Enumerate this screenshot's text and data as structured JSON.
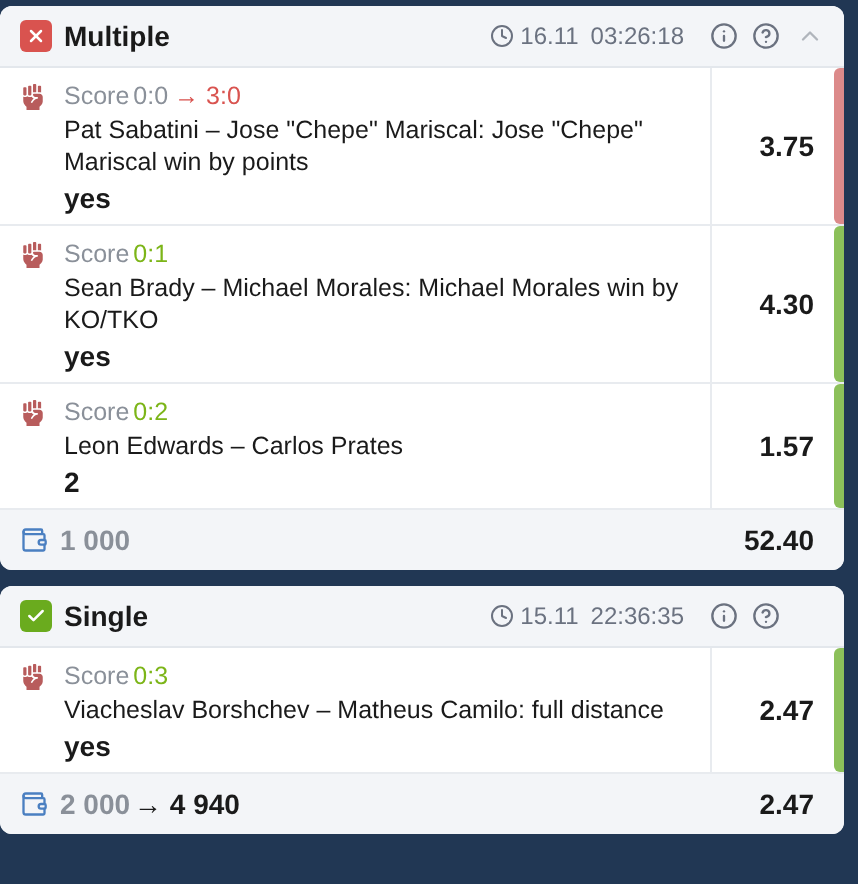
{
  "bets": [
    {
      "type": "Multiple",
      "won": false,
      "date": "16.11",
      "time": "03:26:18",
      "collapsible": true,
      "events": [
        {
          "score_label": "Score",
          "score": "0:0",
          "new_score": "→ 3:0",
          "won": false,
          "description": "Pat Sabatini – Jose \"Chepe\" Mariscal: Jose \"Chepe\" Mariscal win by points",
          "pick": "yes",
          "odds": "3.75"
        },
        {
          "score_label": "Score",
          "score": "0:1",
          "won": true,
          "description": "Sean Brady – Michael Morales: Michael Morales win by KO/TKO",
          "pick": "yes",
          "odds": "4.30"
        },
        {
          "score_label": "Score",
          "score": "0:2",
          "won": true,
          "description": "Leon Edwards – Carlos Prates",
          "pick": "2",
          "odds": "1.57"
        }
      ],
      "stake": "1 000",
      "total_odds": "52.40"
    },
    {
      "type": "Single",
      "won": true,
      "date": "15.11",
      "time": "22:36:35",
      "collapsible": false,
      "events": [
        {
          "score_label": "Score",
          "score": "0:3",
          "won": true,
          "description": "Viacheslav Borshchev – Matheus Camilo: full distance",
          "pick": "yes",
          "odds": "2.47"
        }
      ],
      "stake": "2 000",
      "payout": "→ 4 940",
      "total_odds": "2.47"
    }
  ]
}
